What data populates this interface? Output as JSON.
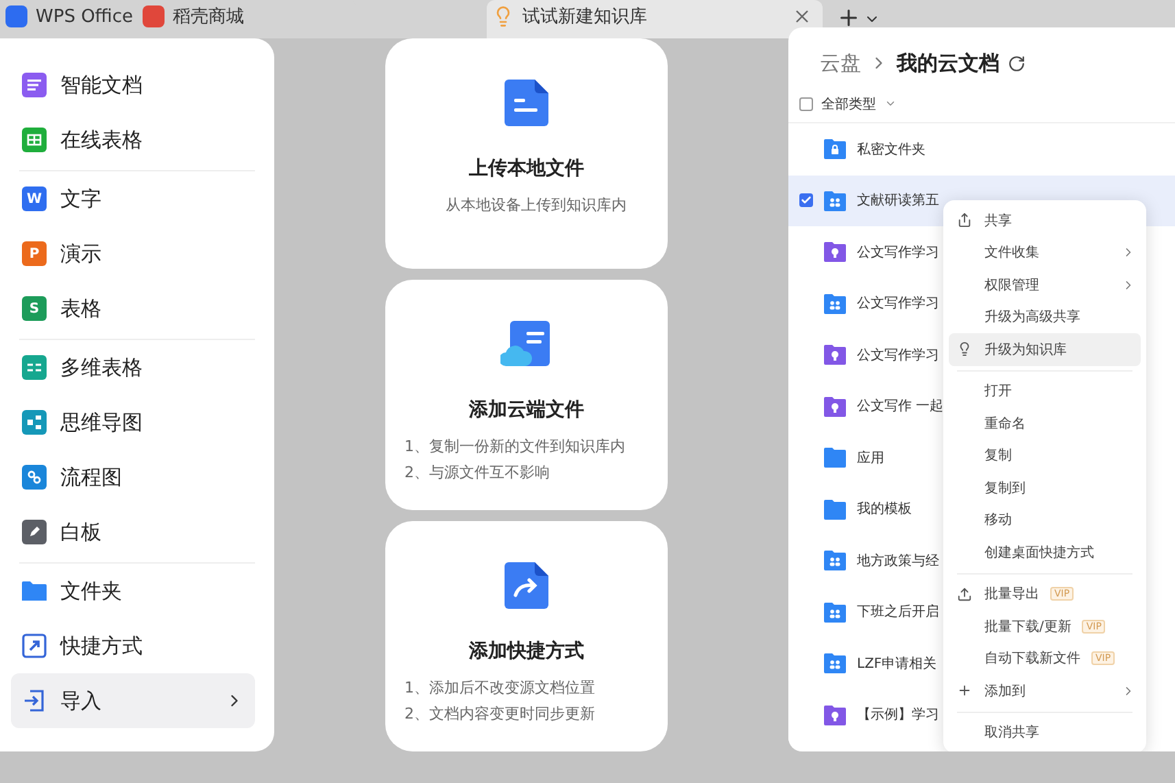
{
  "tabs": [
    {
      "label": "WPS Office",
      "kind": "wps",
      "selected": false
    },
    {
      "label": "稻壳商城",
      "kind": "docer",
      "selected": false
    },
    {
      "label": "试试新建知识库",
      "kind": "bulb",
      "selected": true
    }
  ],
  "new_menu": {
    "groups": [
      [
        {
          "label": "智能文档",
          "kind": "smartdoc",
          "highlighted": false,
          "submenu": false
        },
        {
          "label": "在线表格",
          "kind": "sheet",
          "highlighted": false,
          "submenu": false
        }
      ],
      [
        {
          "label": "文字",
          "kind": "word",
          "badge": "W",
          "highlighted": false,
          "submenu": false
        },
        {
          "label": "演示",
          "kind": "presentation",
          "badge": "P",
          "highlighted": false,
          "submenu": false
        },
        {
          "label": "表格",
          "kind": "spreadsheet",
          "badge": "S",
          "highlighted": false,
          "submenu": false
        }
      ],
      [
        {
          "label": "多维表格",
          "kind": "multi",
          "highlighted": false,
          "submenu": false
        },
        {
          "label": "思维导图",
          "kind": "mind",
          "highlighted": false,
          "submenu": false
        },
        {
          "label": "流程图",
          "kind": "flow",
          "highlighted": false,
          "submenu": false
        },
        {
          "label": "白板",
          "kind": "board",
          "highlighted": false,
          "submenu": false
        }
      ],
      [
        {
          "label": "文件夹",
          "kind": "folder",
          "highlighted": false,
          "submenu": false
        },
        {
          "label": "快捷方式",
          "kind": "shortcut",
          "highlighted": false,
          "submenu": false
        },
        {
          "label": "导入",
          "kind": "import",
          "highlighted": true,
          "submenu": true
        }
      ]
    ]
  },
  "cards": [
    {
      "kind": "upload",
      "title": "上传本地文件",
      "lines": [
        "从本地设备上传到知识库内"
      ]
    },
    {
      "kind": "cloud",
      "title": "添加云端文件",
      "lines": [
        "1、复制一份新的文件到知识库内",
        "2、与源文件互不影响"
      ]
    },
    {
      "kind": "shortcut",
      "title": "添加快捷方式",
      "lines": [
        "1、添加后不改变源文档位置",
        "2、文档内容变更时同步更新"
      ]
    }
  ],
  "cloud": {
    "breadcrumb": {
      "root": "云盘",
      "current": "我的云文档"
    },
    "filter": {
      "label": "全部类型",
      "checked": false
    },
    "rows": [
      {
        "name": "私密文件夹",
        "kind": "private",
        "checked": false,
        "selected": false
      },
      {
        "name": "文献研读第五",
        "kind": "shared",
        "checked": true,
        "selected": true
      },
      {
        "name": "公文写作学习",
        "kind": "knowledge",
        "checked": false,
        "selected": false
      },
      {
        "name": "公文写作学习",
        "kind": "shared",
        "checked": false,
        "selected": false
      },
      {
        "name": "公文写作学习",
        "kind": "knowledge",
        "checked": false,
        "selected": false
      },
      {
        "name": "公文写作 一起",
        "kind": "knowledge",
        "checked": false,
        "selected": false
      },
      {
        "name": "应用",
        "kind": "folder",
        "checked": false,
        "selected": false
      },
      {
        "name": "我的模板",
        "kind": "folder",
        "checked": false,
        "selected": false
      },
      {
        "name": "地方政策与经",
        "kind": "shared",
        "checked": false,
        "selected": false
      },
      {
        "name": "下班之后开启",
        "kind": "shared",
        "checked": false,
        "selected": false
      },
      {
        "name": "LZF申请相关",
        "kind": "shared",
        "checked": false,
        "selected": false
      },
      {
        "name": "【示例】学习",
        "kind": "knowledge",
        "checked": false,
        "selected": false
      }
    ],
    "context_menu": [
      {
        "kind": "share",
        "label": "共享",
        "submenu": false,
        "highlighted": false
      },
      {
        "kind": "plain",
        "label": "文件收集",
        "submenu": true,
        "highlighted": false
      },
      {
        "kind": "plain",
        "label": "权限管理",
        "submenu": true,
        "highlighted": false
      },
      {
        "kind": "plain",
        "label": "升级为高级共享",
        "submenu": false,
        "highlighted": false
      },
      {
        "kind": "bulb",
        "label": "升级为知识库",
        "submenu": false,
        "highlighted": true
      },
      {
        "kind": "divider"
      },
      {
        "kind": "plain",
        "label": "打开",
        "submenu": false,
        "highlighted": false
      },
      {
        "kind": "plain",
        "label": "重命名",
        "submenu": false,
        "highlighted": false
      },
      {
        "kind": "plain",
        "label": "复制",
        "submenu": false,
        "highlighted": false
      },
      {
        "kind": "plain",
        "label": "复制到",
        "submenu": false,
        "highlighted": false
      },
      {
        "kind": "plain",
        "label": "移动",
        "submenu": false,
        "highlighted": false
      },
      {
        "kind": "plain",
        "label": "创建桌面快捷方式",
        "submenu": false,
        "highlighted": false
      },
      {
        "kind": "divider"
      },
      {
        "kind": "export",
        "label": "批量导出",
        "badge": "VIP",
        "submenu": false,
        "highlighted": false
      },
      {
        "kind": "plain",
        "label": "批量下载/更新",
        "badge": "VIP",
        "submenu": false,
        "highlighted": false
      },
      {
        "kind": "plain",
        "label": "自动下载新文件",
        "badge": "VIP",
        "submenu": false,
        "highlighted": false
      },
      {
        "kind": "plus",
        "label": "添加到",
        "submenu": true,
        "highlighted": false
      },
      {
        "kind": "divider"
      },
      {
        "kind": "plain",
        "label": "取消共享",
        "submenu": false,
        "highlighted": false
      }
    ]
  }
}
